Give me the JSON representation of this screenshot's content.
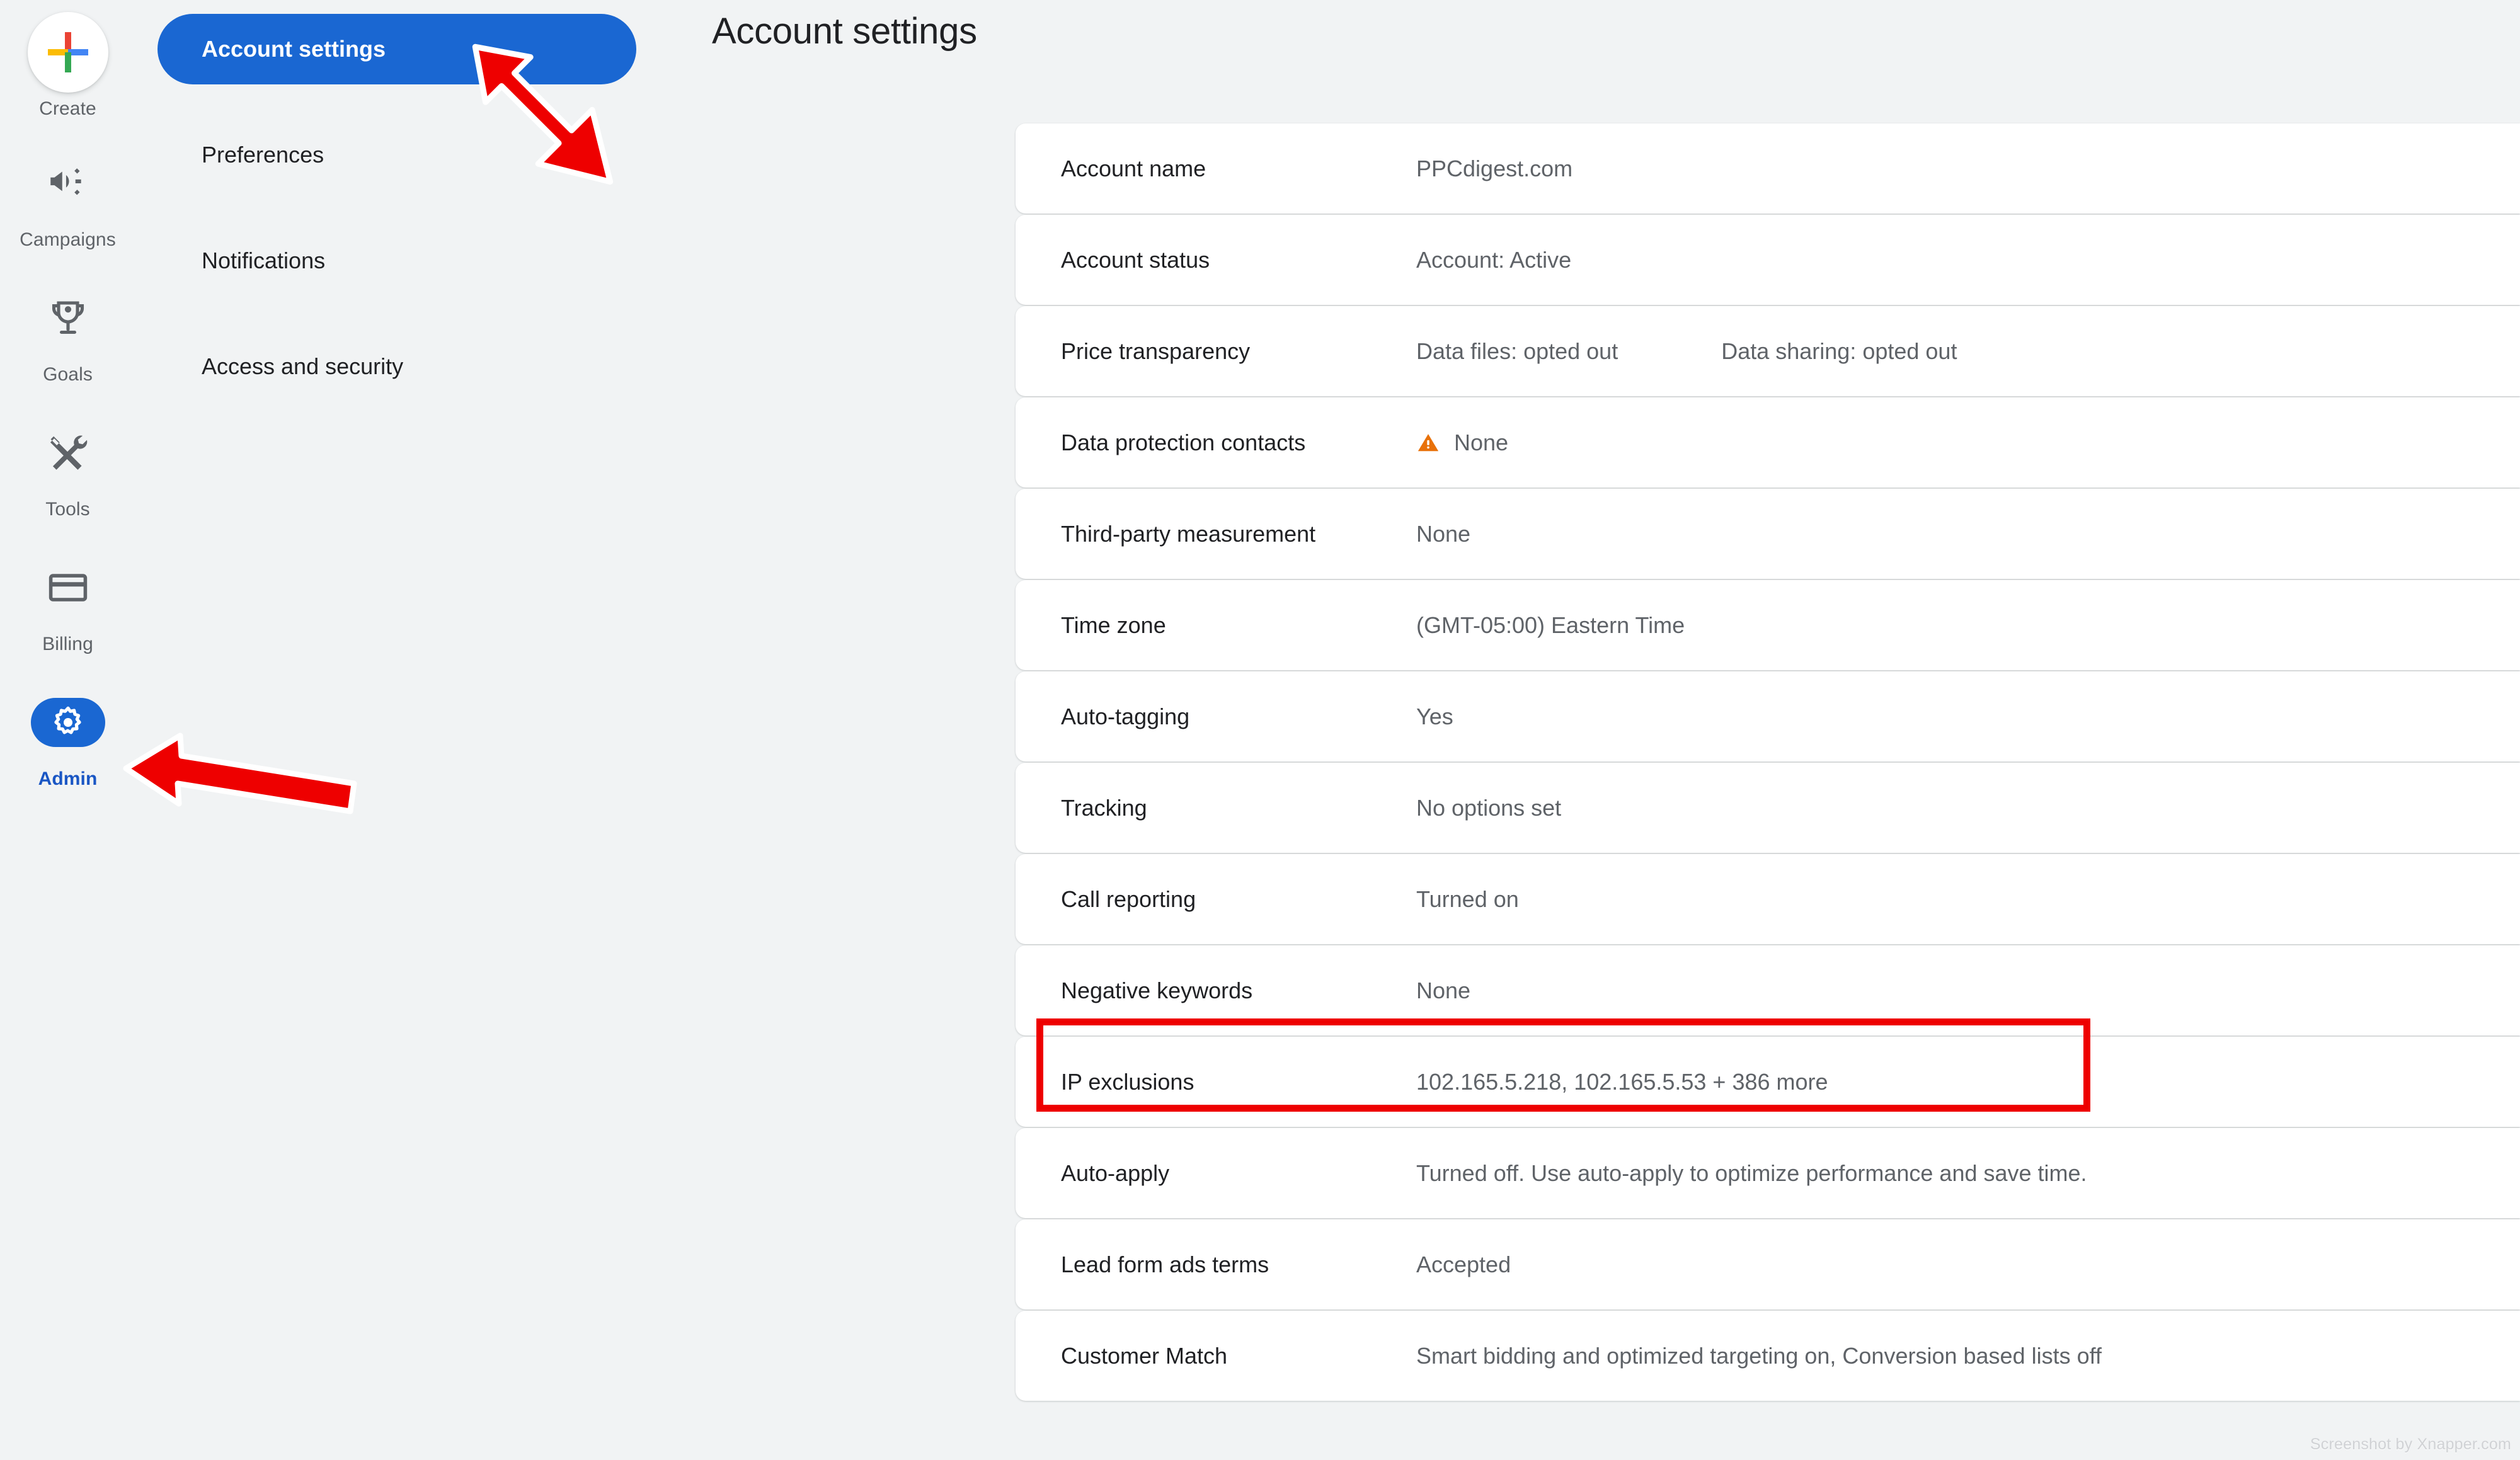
{
  "page": {
    "title": "Account settings",
    "watermark": "Screenshot by Xnapper.com",
    "accent_blue": "#1a67d2",
    "annotation_red": "#ee0000",
    "warning_orange": "#e8710a"
  },
  "rail": {
    "items": [
      {
        "label": "Create",
        "icon": "google-plus-icon"
      },
      {
        "label": "Campaigns",
        "icon": "megaphone-icon"
      },
      {
        "label": "Goals",
        "icon": "trophy-icon"
      },
      {
        "label": "Tools",
        "icon": "tools-icon"
      },
      {
        "label": "Billing",
        "icon": "credit-card-icon"
      },
      {
        "label": "Admin",
        "icon": "gear-icon"
      }
    ]
  },
  "secondary_nav": {
    "items": [
      {
        "label": "Account settings",
        "active": true
      },
      {
        "label": "Preferences",
        "active": false
      },
      {
        "label": "Notifications",
        "active": false
      },
      {
        "label": "Access and security",
        "active": false
      }
    ]
  },
  "settings": {
    "rows": [
      {
        "label": "Account name",
        "value": "PPCdigest.com"
      },
      {
        "label": "Account status",
        "value": "Account: Active"
      },
      {
        "label": "Price transparency",
        "value": "Data files: opted out",
        "value2": "Data sharing: opted out"
      },
      {
        "label": "Data protection contacts",
        "value": "None",
        "warning": true
      },
      {
        "label": "Third-party measurement",
        "value": "None"
      },
      {
        "label": "Time zone",
        "value": "(GMT-05:00) Eastern Time"
      },
      {
        "label": "Auto-tagging",
        "value": "Yes"
      },
      {
        "label": "Tracking",
        "value": "No options set"
      },
      {
        "label": "Call reporting",
        "value": "Turned on"
      },
      {
        "label": "Negative keywords",
        "value": "None"
      },
      {
        "label": "IP exclusions",
        "value": "102.165.5.218, 102.165.5.53 + 386 more",
        "highlighted": true
      },
      {
        "label": "Auto-apply",
        "value": "Turned off. Use auto-apply to optimize performance and save time."
      },
      {
        "label": "Lead form ads terms",
        "value": "Accepted"
      },
      {
        "label": "Customer Match",
        "value": "Smart bidding and optimized targeting on, Conversion based lists off"
      }
    ]
  }
}
